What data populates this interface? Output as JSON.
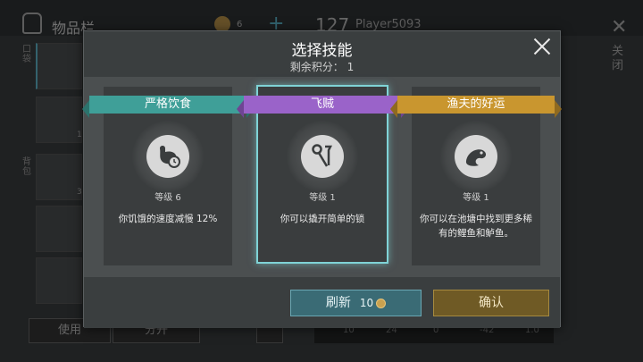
{
  "background": {
    "inventory_title": "物品栏",
    "coin_count": "6",
    "player_level": "127",
    "player_name": "Player5093",
    "close_label": "关闭",
    "side_label_pocket": "口袋",
    "side_label_backpack": "背包",
    "slot_counts": [
      "1",
      "3"
    ],
    "use_button": "使用",
    "split_button": "分开",
    "stats": [
      "10",
      "24",
      "0",
      "-42",
      "1.0"
    ]
  },
  "modal": {
    "title": "选择技能",
    "points_label": "剩余积分：",
    "points_value": "1",
    "cards": [
      {
        "name": "严格饮食",
        "level": "等级 6",
        "description": "你饥饿的速度减慢 12%",
        "ribbon_color": "#3f9f98",
        "icon": "stomach-clock-icon",
        "selected": false
      },
      {
        "name": "飞贼",
        "level": "等级 1",
        "description": "你可以撬开简单的锁",
        "ribbon_color": "#9a63c9",
        "icon": "lockpick-icon",
        "selected": true
      },
      {
        "name": "渔夫的好运",
        "level": "等级 1",
        "description": "你可以在池塘中找到更多稀有的鲤鱼和鲈鱼。",
        "ribbon_color": "#c9962f",
        "icon": "fish-icon",
        "selected": false
      }
    ],
    "refresh_label": "刷新",
    "refresh_cost": "10",
    "confirm_label": "确认",
    "accent_selected": "#7fd3d6"
  }
}
